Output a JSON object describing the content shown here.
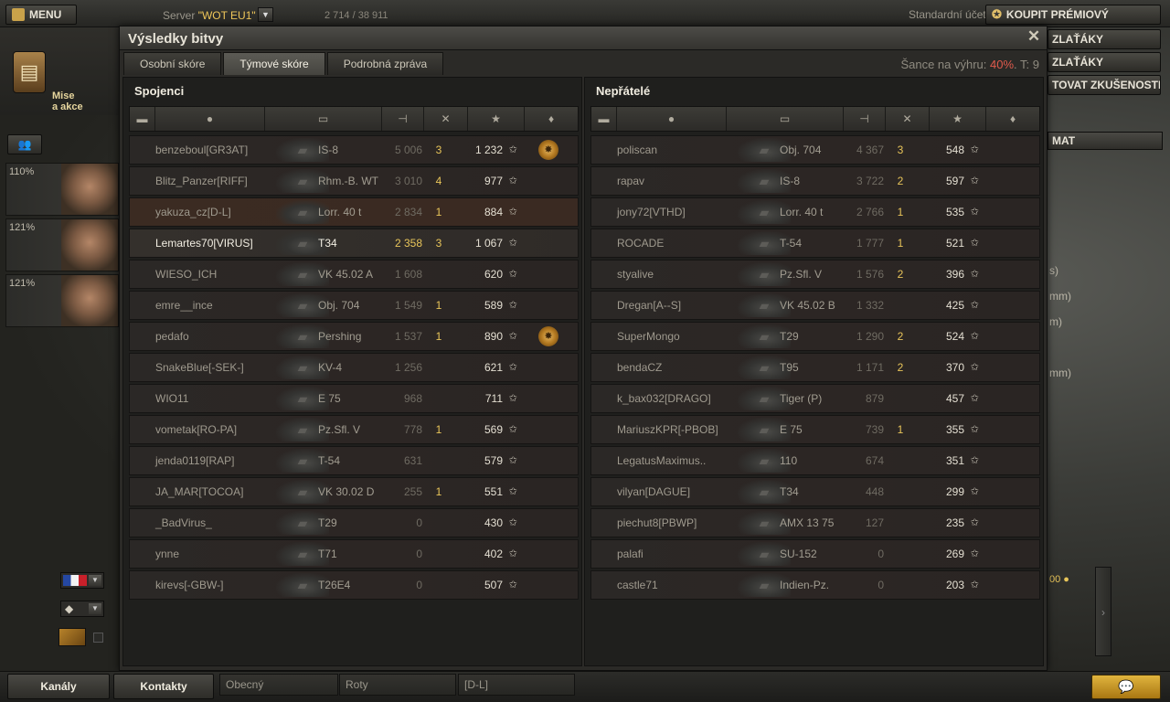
{
  "topbar": {
    "menu_label": "MENU",
    "server_label": "Server",
    "server_name": "\"WOT EU1\"",
    "online_count": "2 714 / 38 911",
    "account_type": "Standardní účet",
    "premium_button": "KOUPIT PRÉMIOVÝ"
  },
  "side_buttons": [
    "ZLAŤÁKY",
    "ZLAŤÁKY",
    "TOVAT ZKUŠENOSTI"
  ],
  "side_panel_label": "MAT",
  "side_stats": [
    "s)",
    "mm)",
    "m)",
    "mm)"
  ],
  "gold_amount": "00",
  "left": {
    "missions_label_1": "Mise",
    "missions_label_2": "a akce",
    "crew": [
      "110%",
      "121%",
      "121%"
    ]
  },
  "window": {
    "title": "Výsledky bitvy",
    "tabs": [
      "Osobní skóre",
      "Týmové skóre",
      "Podrobná zpráva"
    ],
    "chance_label": "Šance na výhru:",
    "chance_value": "40%",
    "tier_label": ". T: 9"
  },
  "allies": {
    "title": "Spojenci",
    "players": [
      {
        "name": "benzeboul[GR3AT]",
        "tank": "IS-8",
        "damage": "5 006",
        "kills": "3",
        "xp": "1 232",
        "medal": true
      },
      {
        "name": "Blitz_Panzer[RIFF]",
        "tank": "Rhm.-B. WT",
        "damage": "3 010",
        "kills": "4",
        "xp": "977",
        "medal": false
      },
      {
        "name": "yakuza_cz[D-L]",
        "tank": "Lorr. 40 t",
        "damage": "2 834",
        "kills": "1",
        "xp": "884",
        "medal": false
      },
      {
        "name": "Lemartes70[VIRUS]",
        "tank": "T34",
        "damage": "2 358",
        "kills": "3",
        "xp": "1 067",
        "medal": false
      },
      {
        "name": "WIESO_ICH",
        "tank": "VK 45.02 A",
        "damage": "1 608",
        "kills": "",
        "xp": "620",
        "medal": false
      },
      {
        "name": "emre__ince",
        "tank": "Obj. 704",
        "damage": "1 549",
        "kills": "1",
        "xp": "589",
        "medal": false
      },
      {
        "name": "pedafo",
        "tank": "Pershing",
        "damage": "1 537",
        "kills": "1",
        "xp": "890",
        "medal": true
      },
      {
        "name": "SnakeBlue[-SEK-]",
        "tank": "KV-4",
        "damage": "1 256",
        "kills": "",
        "xp": "621",
        "medal": false
      },
      {
        "name": "WIO11",
        "tank": "E 75",
        "damage": "968",
        "kills": "",
        "xp": "711",
        "medal": false
      },
      {
        "name": "vometak[RO-PA]",
        "tank": "Pz.Sfl. V",
        "damage": "778",
        "kills": "1",
        "xp": "569",
        "medal": false
      },
      {
        "name": "jenda0119[RAP]",
        "tank": "T-54",
        "damage": "631",
        "kills": "",
        "xp": "579",
        "medal": false
      },
      {
        "name": "JA_MAR[TOCOA]",
        "tank": "VK 30.02 D",
        "damage": "255",
        "kills": "1",
        "xp": "551",
        "medal": false
      },
      {
        "name": "_BadVirus_",
        "tank": "T29",
        "damage": "0",
        "kills": "",
        "xp": "430",
        "medal": false
      },
      {
        "name": "ynne",
        "tank": "T71",
        "damage": "0",
        "kills": "",
        "xp": "402",
        "medal": false
      },
      {
        "name": "kirevs[-GBW-]",
        "tank": "T26E4",
        "damage": "0",
        "kills": "",
        "xp": "507",
        "medal": false
      }
    ]
  },
  "enemies": {
    "title": "Nepřátelé",
    "players": [
      {
        "name": "poliscan",
        "tank": "Obj. 704",
        "damage": "4 367",
        "kills": "3",
        "xp": "548",
        "medal": false
      },
      {
        "name": "rapav",
        "tank": "IS-8",
        "damage": "3 722",
        "kills": "2",
        "xp": "597",
        "medal": false
      },
      {
        "name": "jony72[VTHD]",
        "tank": "Lorr. 40 t",
        "damage": "2 766",
        "kills": "1",
        "xp": "535",
        "medal": false
      },
      {
        "name": "ROCADE",
        "tank": "T-54",
        "damage": "1 777",
        "kills": "1",
        "xp": "521",
        "medal": false
      },
      {
        "name": "styalive",
        "tank": "Pz.Sfl. V",
        "damage": "1 576",
        "kills": "2",
        "xp": "396",
        "medal": false
      },
      {
        "name": "Dregan[A--S]",
        "tank": "VK 45.02 B",
        "damage": "1 332",
        "kills": "",
        "xp": "425",
        "medal": false
      },
      {
        "name": "SuperMongo",
        "tank": "T29",
        "damage": "1 290",
        "kills": "2",
        "xp": "524",
        "medal": false
      },
      {
        "name": "bendaCZ",
        "tank": "T95",
        "damage": "1 171",
        "kills": "2",
        "xp": "370",
        "medal": false
      },
      {
        "name": "k_bax032[DRAGO]",
        "tank": "Tiger (P)",
        "damage": "879",
        "kills": "",
        "xp": "457",
        "medal": false
      },
      {
        "name": "MariuszKPR[-PBOB]",
        "tank": "E 75",
        "damage": "739",
        "kills": "1",
        "xp": "355",
        "medal": false
      },
      {
        "name": "LegatusMaximus..",
        "tank": "110",
        "damage": "674",
        "kills": "",
        "xp": "351",
        "medal": false
      },
      {
        "name": "vilyan[DAGUE]",
        "tank": "T34",
        "damage": "448",
        "kills": "",
        "xp": "299",
        "medal": false
      },
      {
        "name": "piechut8[PBWP]",
        "tank": "AMX 13 75",
        "damage": "127",
        "kills": "",
        "xp": "235",
        "medal": false
      },
      {
        "name": "palafi",
        "tank": "SU-152",
        "damage": "0",
        "kills": "",
        "xp": "269",
        "medal": false
      },
      {
        "name": "castle71",
        "tank": "Indien-Pz.",
        "damage": "0",
        "kills": "",
        "xp": "203",
        "medal": false
      }
    ]
  },
  "bottombar": {
    "channels": "Kanály",
    "contacts": "Kontakty",
    "chan_tabs": [
      "Obecný",
      "Roty",
      "[D-L]"
    ]
  },
  "colors": {
    "accent_gold": "#e8c55a",
    "chance_red": "#e05a4c",
    "chat_button": "#d4a42e"
  }
}
